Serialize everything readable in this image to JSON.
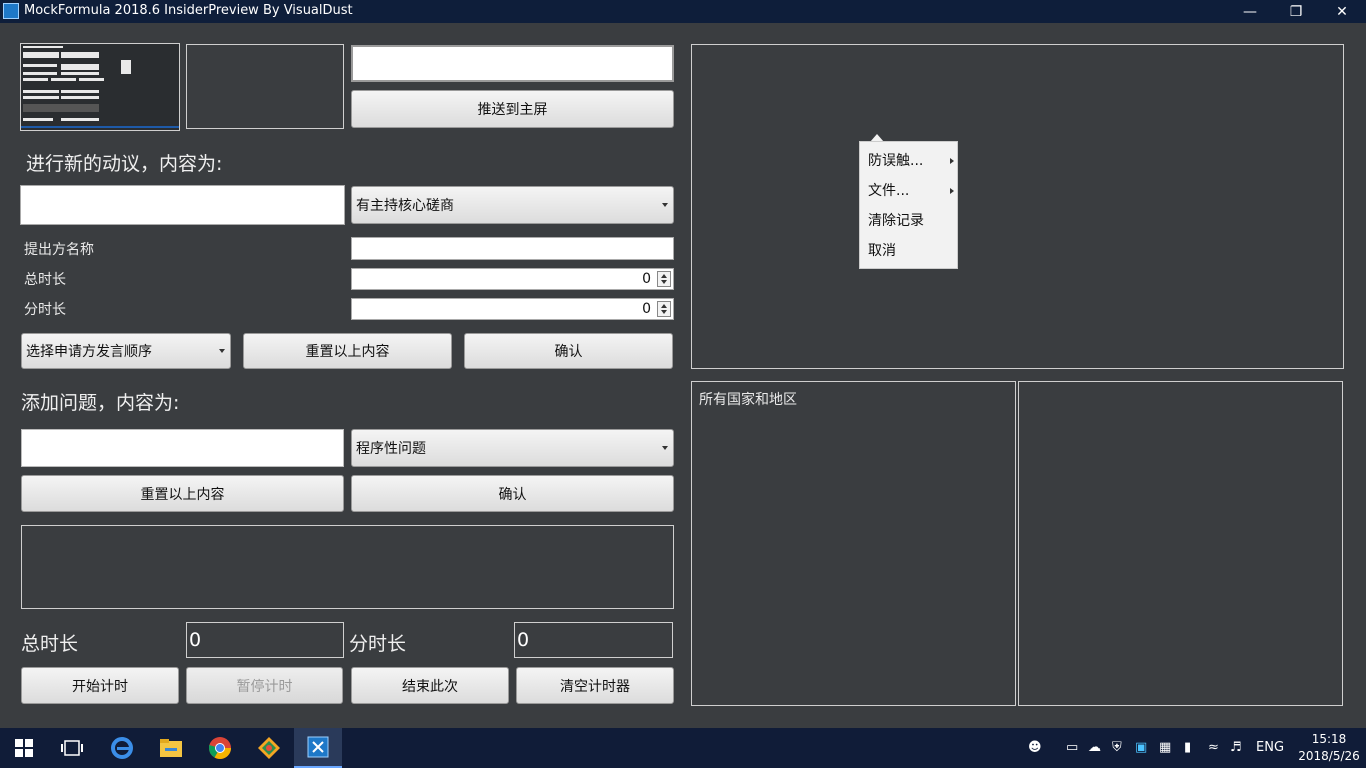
{
  "window": {
    "title": "MockFormula 2018.6 InsiderPreview By VisualDust"
  },
  "top": {
    "push_button": "推送到主屏"
  },
  "motion": {
    "heading": "进行新的动议，内容为:",
    "type_selected": "有主持核心磋商",
    "proposer_label": "提出方名称",
    "total_label": "总时长",
    "total_value": "0",
    "per_label": "分时长",
    "per_value": "0",
    "order_selected": "选择申请方发言顺序",
    "reset_button": "重置以上内容",
    "confirm_button": "确认"
  },
  "question": {
    "heading": "添加问题，内容为:",
    "type_selected": "程序性问题",
    "reset_button": "重置以上内容",
    "confirm_button": "确认"
  },
  "timer": {
    "total_label": "总时长",
    "total_value": "0",
    "per_label": "分时长",
    "per_value": "0",
    "start_button": "开始计时",
    "pause_button": "暂停计时",
    "end_button": "结束此次",
    "clear_button": "清空计时器"
  },
  "context_menu": {
    "items": [
      "防误触...",
      "文件...",
      "清除记录",
      "取消"
    ]
  },
  "countries": {
    "header": "所有国家和地区"
  },
  "taskbar": {
    "language": "ENG",
    "time": "15:18",
    "date": "2018/5/26"
  },
  "colors": {
    "background": "#3a3d40",
    "titlebar": "#0e1e3a",
    "taskbar": "#101c38",
    "accent": "#1e78c8"
  }
}
